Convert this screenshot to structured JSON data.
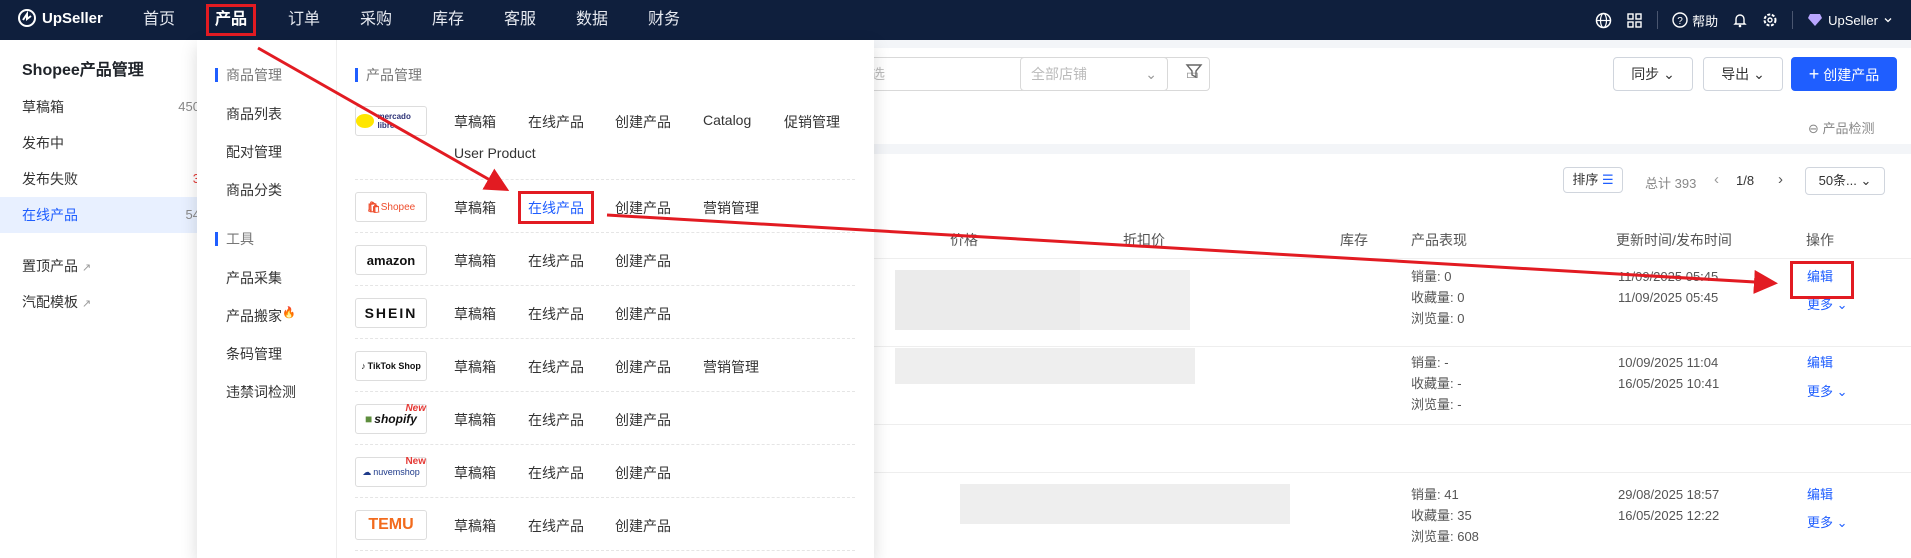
{
  "nav": {
    "brand": "UpSeller",
    "items": [
      "首页",
      "产品",
      "订单",
      "采购",
      "库存",
      "客服",
      "数据",
      "财务"
    ],
    "help_label": "帮助",
    "user_label": "UpSeller"
  },
  "sidebar": {
    "title": "Shopee产品管理",
    "items": [
      {
        "label": "草稿箱",
        "count": "450"
      },
      {
        "label": "发布中",
        "count": ""
      },
      {
        "label": "发布失败",
        "count": "3"
      },
      {
        "label": "在线产品",
        "count": "54"
      },
      {
        "label": "置顶产品",
        "count": ""
      },
      {
        "label": "汽配模板",
        "count": ""
      }
    ]
  },
  "toolbar": {
    "date_placeholder": "选",
    "store_placeholder": "全部店铺",
    "sync_label": "同步",
    "export_label": "导出",
    "create_label": "创建产品",
    "detect_label": "产品检测"
  },
  "table": {
    "sort_label": "排序",
    "total_label": "总计 393",
    "page_label": "1/8",
    "page_size_label": "50条...",
    "headers": {
      "price": "价格",
      "discount": "折扣价",
      "stock": "库存",
      "perf": "产品表现",
      "time": "更新时间/发布时间",
      "ops": "操作"
    },
    "rows": [
      {
        "sales": "销量: 0",
        "favs": "收藏量: 0",
        "views": "浏览量: 0",
        "updated": "11/09/2025 05:45",
        "published": "11/09/2025 05:45",
        "edit": "编辑",
        "more": "更多"
      },
      {
        "sales": "销量: -",
        "favs": "收藏量: -",
        "views": "浏览量: -",
        "updated": "10/09/2025 11:04",
        "published": "16/05/2025 10:41",
        "edit": "编辑",
        "more": "更多"
      },
      {
        "sales": "销量: 41",
        "favs": "收藏量: 35",
        "views": "浏览量: 608",
        "updated": "29/08/2025 18:57",
        "published": "16/05/2025 12:22",
        "edit": "编辑",
        "more": "更多"
      }
    ]
  },
  "menu": {
    "goods_section": "商品管理",
    "goods_items": [
      "商品列表",
      "配对管理",
      "商品分类"
    ],
    "tools_section": "工具",
    "tools_items": [
      "产品采集",
      "产品搬家",
      "条码管理",
      "违禁词检测"
    ],
    "product_section": "产品管理",
    "platforms": [
      {
        "name": "mercado libre",
        "links": [
          "草稿箱",
          "在线产品",
          "创建产品",
          "Catalog",
          "促销管理",
          "User Product"
        ],
        "badge": ""
      },
      {
        "name": "Shopee",
        "links": [
          "草稿箱",
          "在线产品",
          "创建产品",
          "营销管理"
        ],
        "badge": ""
      },
      {
        "name": "amazon",
        "links": [
          "草稿箱",
          "在线产品",
          "创建产品"
        ],
        "badge": ""
      },
      {
        "name": "SHEIN",
        "links": [
          "草稿箱",
          "在线产品",
          "创建产品"
        ],
        "badge": ""
      },
      {
        "name": "TikTok Shop",
        "links": [
          "草稿箱",
          "在线产品",
          "创建产品",
          "营销管理"
        ],
        "badge": ""
      },
      {
        "name": "shopify",
        "links": [
          "草稿箱",
          "在线产品",
          "创建产品"
        ],
        "badge": "New"
      },
      {
        "name": "nuvemshop",
        "links": [
          "草稿箱",
          "在线产品",
          "创建产品"
        ],
        "badge": "New"
      },
      {
        "name": "TEMU",
        "links": [
          "草稿箱",
          "在线产品",
          "创建产品"
        ],
        "badge": ""
      }
    ]
  },
  "colors": {
    "accent": "#1f5eff",
    "nav_bg": "#0f1f3d",
    "highlight": "#e21b22"
  }
}
